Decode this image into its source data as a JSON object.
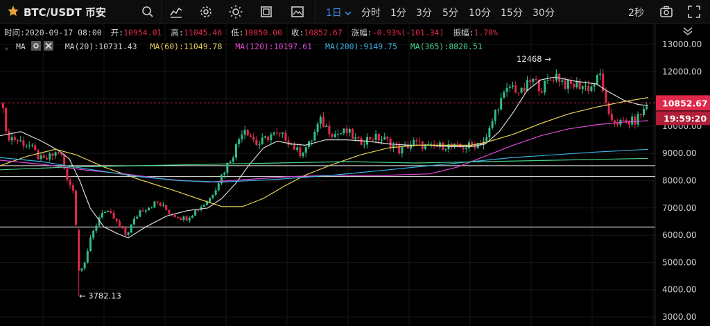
{
  "header": {
    "title": "BTC/USDT 币安",
    "interval_active": "1日",
    "intervals": [
      "分时",
      "1分",
      "3分",
      "5分",
      "10分",
      "15分",
      "30分"
    ],
    "refresh": "2秒",
    "icons": [
      "star-icon",
      "search-icon",
      "indicator-icon",
      "settings-icon",
      "theme-icon",
      "layout-icon",
      "image-icon",
      "chevron-down-icon",
      "camera-icon",
      "fullscreen-icon",
      "collapse-icon"
    ]
  },
  "info": {
    "time_label": "时间:",
    "time": "2020-09-17 08:00",
    "open_label": "开:",
    "open": "10954.01",
    "high_label": "高:",
    "high": "11045.46",
    "low_label": "低:",
    "low": "10850.00",
    "close_label": "收:",
    "close": "10852.67",
    "change_label": "涨幅:",
    "change": "-0.93%(-101.34)",
    "amp_label": "振幅:",
    "amp": "1.78%"
  },
  "ma": {
    "caret": "⌄",
    "label": "MA",
    "items": [
      {
        "text": "MA(20):10731.43",
        "color": "#d8d8d8"
      },
      {
        "text": "MA(60):11049.78",
        "color": "#e6d15a"
      },
      {
        "text": "MA(120):10197.61",
        "color": "#e04ad8"
      },
      {
        "text": "MA(200):9149.75",
        "color": "#3ab0e0"
      },
      {
        "text": "MA(365):8820.51",
        "color": "#4ad08a"
      }
    ]
  },
  "chart_data": {
    "type": "candlestick",
    "ylim": [
      2800,
      13400
    ],
    "y_ticks": [
      "13000.00",
      "12000.00",
      "11000.00",
      "10000.00",
      "9000.00",
      "8000.00",
      "7000.00",
      "6000.00",
      "5000.00",
      "4000.00",
      "3000.00"
    ],
    "y_tick_values": [
      13000,
      12000,
      11000,
      10000,
      9000,
      8000,
      7000,
      6000,
      5000,
      4000,
      3000
    ],
    "current_price": "10852.67",
    "current_price_value": 10852.67,
    "countdown": "19:59:20",
    "high_annotation": "12468 →",
    "high_annotation_value": 12468,
    "low_annotation": "← 3782.13",
    "low_annotation_value": 3782.13,
    "horizontal_lines": [
      8550,
      8150,
      6300
    ],
    "colors": {
      "up": "#2ebd85",
      "down": "#e0294a",
      "grid": "#161616",
      "bg": "#000000"
    },
    "ma_series": [
      {
        "name": "MA(20)",
        "color": "#d8d8d8",
        "points": [
          [
            0,
            9650
          ],
          [
            30,
            9800
          ],
          [
            60,
            9450
          ],
          [
            85,
            9100
          ],
          [
            100,
            8800
          ],
          [
            115,
            8000
          ],
          [
            130,
            7000
          ],
          [
            150,
            6300
          ],
          [
            170,
            6050
          ],
          [
            185,
            5900
          ],
          [
            210,
            6300
          ],
          [
            240,
            6700
          ],
          [
            270,
            6900
          ],
          [
            300,
            7000
          ],
          [
            320,
            7350
          ],
          [
            340,
            7900
          ],
          [
            360,
            8600
          ],
          [
            380,
            9200
          ],
          [
            400,
            9450
          ],
          [
            420,
            9350
          ],
          [
            440,
            9300
          ],
          [
            470,
            9500
          ],
          [
            500,
            9500
          ],
          [
            530,
            9450
          ],
          [
            560,
            9350
          ],
          [
            590,
            9300
          ],
          [
            620,
            9300
          ],
          [
            650,
            9250
          ],
          [
            680,
            9250
          ],
          [
            700,
            9350
          ],
          [
            720,
            9800
          ],
          [
            740,
            10500
          ],
          [
            760,
            11300
          ],
          [
            780,
            11700
          ],
          [
            800,
            11800
          ],
          [
            830,
            11650
          ],
          [
            860,
            11550
          ],
          [
            875,
            11300
          ],
          [
            900,
            10950
          ],
          [
            920,
            10800
          ],
          [
            935,
            10750
          ]
        ]
      },
      {
        "name": "MA(60)",
        "color": "#e6d15a",
        "points": [
          [
            0,
            8550
          ],
          [
            40,
            8900
          ],
          [
            80,
            9150
          ],
          [
            110,
            8950
          ],
          [
            150,
            8500
          ],
          [
            200,
            8050
          ],
          [
            250,
            7650
          ],
          [
            290,
            7300
          ],
          [
            320,
            7050
          ],
          [
            350,
            7050
          ],
          [
            380,
            7350
          ],
          [
            410,
            7800
          ],
          [
            440,
            8200
          ],
          [
            480,
            8600
          ],
          [
            520,
            8950
          ],
          [
            560,
            9200
          ],
          [
            600,
            9300
          ],
          [
            640,
            9300
          ],
          [
            680,
            9300
          ],
          [
            700,
            9400
          ],
          [
            740,
            9700
          ],
          [
            780,
            10100
          ],
          [
            820,
            10450
          ],
          [
            860,
            10700
          ],
          [
            900,
            10900
          ],
          [
            935,
            11050
          ]
        ]
      },
      {
        "name": "MA(120)",
        "color": "#e04ad8",
        "points": [
          [
            0,
            8750
          ],
          [
            60,
            8600
          ],
          [
            120,
            8400
          ],
          [
            180,
            8250
          ],
          [
            240,
            8050
          ],
          [
            300,
            7950
          ],
          [
            360,
            8050
          ],
          [
            420,
            8150
          ],
          [
            480,
            8200
          ],
          [
            560,
            8200
          ],
          [
            620,
            8250
          ],
          [
            660,
            8500
          ],
          [
            700,
            8900
          ],
          [
            740,
            9300
          ],
          [
            780,
            9650
          ],
          [
            820,
            9900
          ],
          [
            860,
            10050
          ],
          [
            900,
            10150
          ],
          [
            935,
            10200
          ]
        ]
      },
      {
        "name": "MA(200)",
        "color": "#3ab0e0",
        "points": [
          [
            0,
            8850
          ],
          [
            60,
            8700
          ],
          [
            120,
            8450
          ],
          [
            200,
            8150
          ],
          [
            260,
            8000
          ],
          [
            320,
            7950
          ],
          [
            400,
            8050
          ],
          [
            480,
            8200
          ],
          [
            560,
            8400
          ],
          [
            620,
            8550
          ],
          [
            680,
            8700
          ],
          [
            740,
            8850
          ],
          [
            800,
            8950
          ],
          [
            860,
            9050
          ],
          [
            935,
            9150
          ]
        ]
      },
      {
        "name": "MA(365)",
        "color": "#4ad08a",
        "points": [
          [
            0,
            8400
          ],
          [
            100,
            8500
          ],
          [
            200,
            8550
          ],
          [
            300,
            8600
          ],
          [
            400,
            8650
          ],
          [
            500,
            8700
          ],
          [
            600,
            8650
          ],
          [
            700,
            8700
          ],
          [
            800,
            8750
          ],
          [
            935,
            8820
          ]
        ]
      }
    ],
    "anchors": [
      [
        5,
        9700
      ],
      [
        40,
        9300
      ],
      [
        60,
        8700
      ],
      [
        85,
        9100
      ],
      [
        95,
        8000
      ],
      [
        105,
        7700
      ],
      [
        112,
        4700
      ],
      [
        120,
        5000
      ],
      [
        130,
        5900
      ],
      [
        145,
        6900
      ],
      [
        160,
        6700
      ],
      [
        180,
        6000
      ],
      [
        200,
        6900
      ],
      [
        225,
        7200
      ],
      [
        245,
        6800
      ],
      [
        265,
        6600
      ],
      [
        285,
        7000
      ],
      [
        300,
        7300
      ],
      [
        318,
        8200
      ],
      [
        335,
        9000
      ],
      [
        350,
        10000
      ],
      [
        370,
        9300
      ],
      [
        390,
        9700
      ],
      [
        410,
        9600
      ],
      [
        430,
        9000
      ],
      [
        445,
        9350
      ],
      [
        460,
        10200
      ],
      [
        480,
        9700
      ],
      [
        500,
        9800
      ],
      [
        515,
        9400
      ],
      [
        535,
        9600
      ],
      [
        555,
        9500
      ],
      [
        575,
        9100
      ],
      [
        595,
        9400
      ],
      [
        620,
        9200
      ],
      [
        640,
        9300
      ],
      [
        660,
        9200
      ],
      [
        680,
        9300
      ],
      [
        700,
        9500
      ],
      [
        715,
        10700
      ],
      [
        735,
        11500
      ],
      [
        750,
        11200
      ],
      [
        765,
        11700
      ],
      [
        780,
        11400
      ],
      [
        800,
        11900
      ],
      [
        815,
        11500
      ],
      [
        835,
        11500
      ],
      [
        850,
        11400
      ],
      [
        865,
        11900
      ],
      [
        875,
        10300
      ],
      [
        895,
        10100
      ],
      [
        915,
        10200
      ],
      [
        935,
        10850
      ]
    ]
  }
}
